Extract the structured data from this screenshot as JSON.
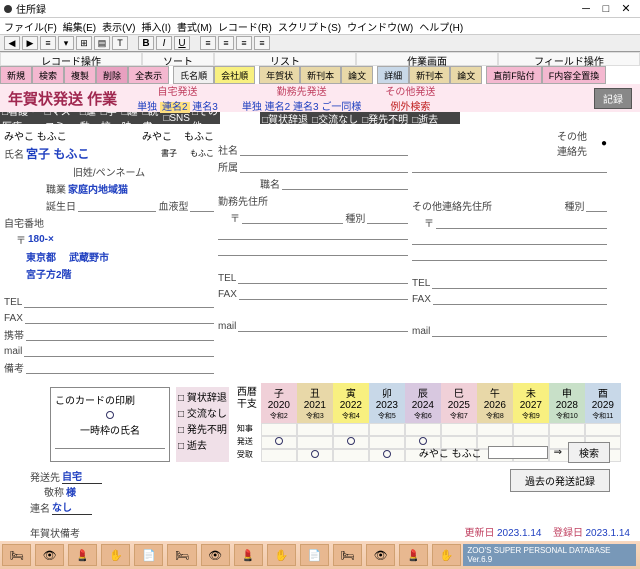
{
  "window": {
    "title": "住所録"
  },
  "menu": [
    "ファイル(F)",
    "編集(E)",
    "表示(V)",
    "挿入(I)",
    "書式(M)",
    "レコード(R)",
    "スクリプト(S)",
    "ウインドウ(W)",
    "ヘルプ(H)"
  ],
  "sections": {
    "a": "レコード操作",
    "b": "ソート",
    "c": "リスト",
    "d": "作業画面",
    "e": "フィールド操作"
  },
  "actions": {
    "rec": [
      "新規",
      "検索",
      "複製",
      "削除",
      "全表示"
    ],
    "sort": [
      "氏名順",
      "会社順"
    ],
    "list": [
      "年賀状",
      "新刊本",
      "論文"
    ],
    "work": [
      "詳細",
      "新刊本",
      "論文"
    ],
    "field": [
      "直前F貼付",
      "F内容全置換"
    ]
  },
  "header2": {
    "title": "年賀状発送 作業",
    "home": {
      "lbl": "自宅発送",
      "opts": [
        "単独",
        "連名2",
        "連名3"
      ]
    },
    "work": {
      "lbl": "勤務先発送",
      "opts": [
        "単独",
        "連名2",
        "連名3",
        "ご一同様"
      ]
    },
    "other": {
      "lbl": "その他発送",
      "opt": "例外検索"
    },
    "reg": "記録"
  },
  "darkL": [
    "看護・医療",
    "マスコミ",
    "運動",
    "学校",
    "趣味",
    "読書",
    "SNS",
    "その他"
  ],
  "darkR": [
    "賀状辞退",
    "交流なし",
    "発先不明",
    "逝去"
  ],
  "person": {
    "name_lbl": "氏名",
    "name": "宮子 もふこ",
    "kana": "みやこ もふこ",
    "kana2": "みやこ",
    "kana3": "もふこ",
    "pen_lbl": "旧姓/ペンネーム",
    "pen_k": "書子",
    "pen_v": "もふこ",
    "occ_lbl": "職業",
    "occ": "家庭内地域猫",
    "bday_lbl": "誕生日",
    "blood_lbl": "血液型",
    "addr_lbl": "自宅番地",
    "zip_lbl": "〒",
    "zip": "180-×",
    "addr1": "東京都",
    "addr2": "武蔵野市",
    "addr3": "宮子方2階",
    "tel": "TEL",
    "fax": "FAX",
    "mob": "携帯",
    "mail": "mail",
    "memo": "備考"
  },
  "work": {
    "co": "社名",
    "dept": "所属",
    "title": "職名",
    "addr": "勤務先住所",
    "zip": "〒",
    "type": "種別"
  },
  "other": {
    "lbl": "その他\n連絡先",
    "addr": "その他連絡先住所",
    "zip": "〒",
    "type": "種別"
  },
  "years": {
    "hdr": [
      "西暦",
      "干支"
    ],
    "rows": [
      "知事",
      "発送",
      "受取"
    ],
    "cols": [
      {
        "y": "2020",
        "e": "子",
        "r": "令和2",
        "c": "c-pink"
      },
      {
        "y": "2021",
        "e": "丑",
        "r": "令和3",
        "c": "c-tan"
      },
      {
        "y": "2022",
        "e": "寅",
        "r": "令和4",
        "c": "c-yel"
      },
      {
        "y": "2023",
        "e": "卯",
        "r": "令和5",
        "c": "c-blue"
      },
      {
        "y": "2024",
        "e": "辰",
        "r": "令和6",
        "c": "c-pur"
      },
      {
        "y": "2025",
        "e": "巳",
        "r": "令和7",
        "c": "c-pink"
      },
      {
        "y": "2026",
        "e": "午",
        "r": "令和8",
        "c": "c-tan"
      },
      {
        "y": "2027",
        "e": "未",
        "r": "令和9",
        "c": "c-yel"
      },
      {
        "y": "2028",
        "e": "申",
        "r": "令和10",
        "c": "c-grn"
      },
      {
        "y": "2029",
        "e": "酉",
        "r": "令和11",
        "c": "c-blue"
      }
    ],
    "marks": {
      "send": [
        0,
        2,
        4
      ],
      "recv": [
        1,
        3
      ]
    }
  },
  "print": {
    "box": "このカードの印刷",
    "tmp": "一時枠の氏名",
    "chk": [
      "賀状辞退",
      "交流なし",
      "発先不明",
      "逝去"
    ]
  },
  "send": {
    "to_lbl": "発送先",
    "to": "自宅",
    "hon_lbl": "敬称",
    "hon": "様",
    "con_lbl": "連名",
    "con": "なし"
  },
  "search": {
    "name": "みやこ もふこ",
    "arrow": "⇒",
    "btn": "検索",
    "hist": "過去の発送記録",
    "memo_lbl": "年賀状備考"
  },
  "dates": {
    "upd_l": "更新日",
    "upd": "2023.1.14",
    "reg_l": "登録日",
    "reg": "2023.1.14"
  },
  "footer": {
    "ver": "ZOO'S SUPER PERSONAL DATABASE Ver.6.9"
  }
}
